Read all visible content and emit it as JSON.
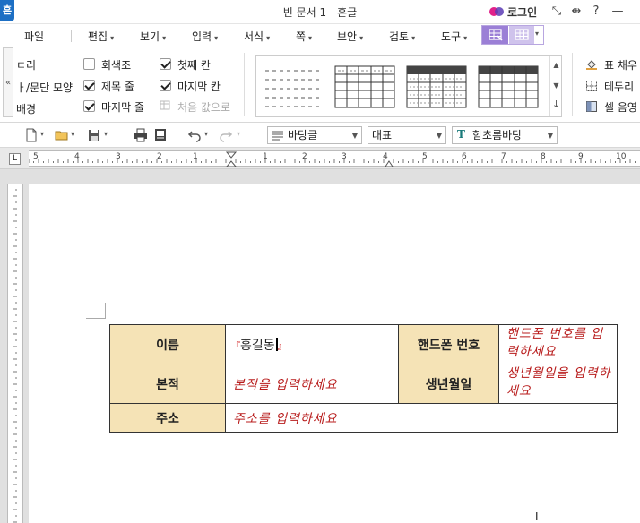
{
  "window": {
    "app_icon_char": "흔",
    "title": "빈 문서 1 - 흔글",
    "login_label": "로그인",
    "controls": [
      "⤡",
      "⇹",
      "?",
      "—"
    ]
  },
  "menu": {
    "items": [
      {
        "label": "파일",
        "has_caret": false
      },
      {
        "label": "편집",
        "has_caret": true
      },
      {
        "label": "보기",
        "has_caret": true
      },
      {
        "label": "입력",
        "has_caret": true
      },
      {
        "label": "서식",
        "has_caret": true
      },
      {
        "label": "쪽",
        "has_caret": true
      },
      {
        "label": "보안",
        "has_caret": true
      },
      {
        "label": "검토",
        "has_caret": true
      },
      {
        "label": "도구",
        "has_caret": true
      }
    ]
  },
  "ribbon": {
    "collapse_glyph": "«",
    "left_labels": [
      "ㄷ리",
      "ㅏ/문단 모양",
      "배경"
    ],
    "checkboxes": [
      {
        "label": "회색조",
        "checked": false
      },
      {
        "label": "제목 줄",
        "checked": true
      },
      {
        "label": "마지막 줄",
        "checked": true
      },
      {
        "label": "첫째 칸",
        "checked": true
      },
      {
        "label": "마지막 칸",
        "checked": true
      }
    ],
    "reset_label": "처음 값으로",
    "right_items": [
      {
        "label": "표 채우",
        "icon": "paint-bucket-icon"
      },
      {
        "label": "테두리",
        "icon": "border-icon"
      },
      {
        "label": "셀 음영",
        "icon": "cell-shade-icon"
      }
    ],
    "scroll_glyphs": [
      "▲",
      "▼",
      "↓"
    ]
  },
  "toolbar": {
    "paragraph_style": "바탕글",
    "representative": "대표",
    "font": "함초롬바탕"
  },
  "ruler": {
    "marks": [
      "5",
      "4",
      "3",
      "2",
      "1",
      "1",
      "2",
      "3",
      "4",
      "5",
      "6",
      "7",
      "8",
      "9",
      "10"
    ]
  },
  "table": {
    "rows": [
      {
        "h1": "이름",
        "v1": "홍길동",
        "h2": "핸드폰 번호",
        "v2": "핸드폰 번호를 입력하세요"
      },
      {
        "h1": "본적",
        "v1": "본적을 입력하세요",
        "h2": "생년월일",
        "v2": "생년월일을 입력하세요"
      },
      {
        "h1": "주소",
        "v1": "주소를 입력하세요"
      }
    ],
    "field_open": "『",
    "field_close": "』"
  },
  "colors": {
    "header_fill": "#f5e3b6",
    "placeholder_text": "#b81c1c",
    "accent_purple": "#9b7fd6"
  }
}
